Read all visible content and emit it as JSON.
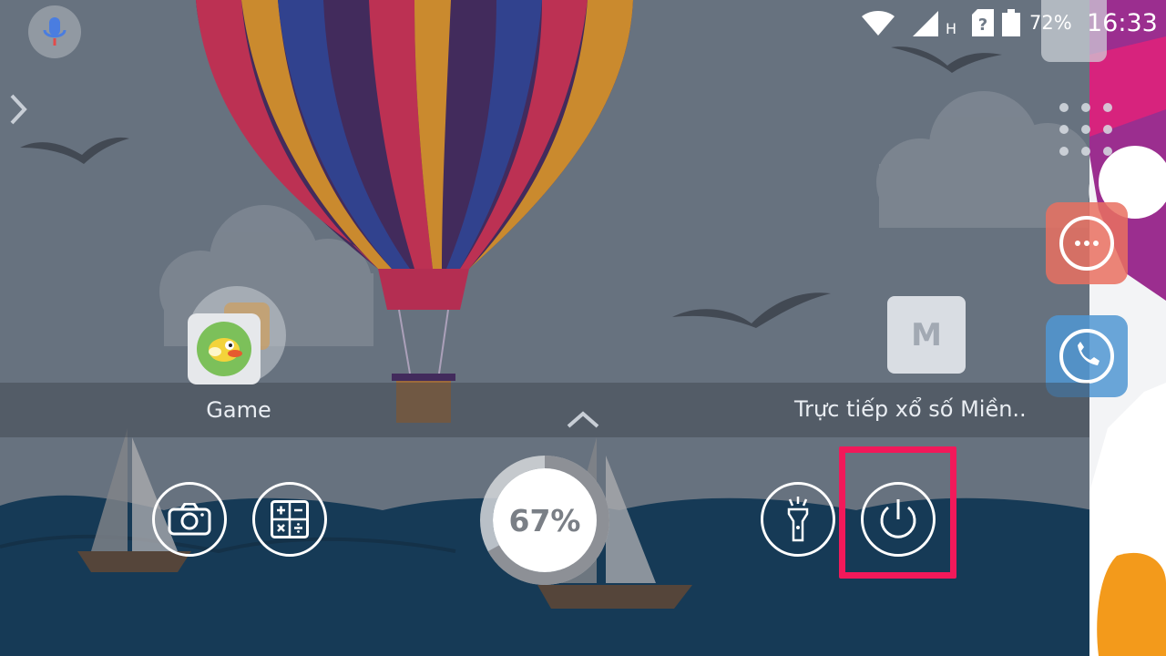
{
  "status_bar": {
    "network_letter": "H",
    "battery_percent": "72%",
    "time": "16:33"
  },
  "home": {
    "folder_label": "Game",
    "shortcut_label": "Trực tiếp xổ số Miền..",
    "m_app_letter": "M"
  },
  "quick_panel": {
    "memory_percent_text": "67%",
    "memory_fraction": 0.67
  },
  "icons": [
    "mic-icon",
    "chevron-right-icon",
    "chevron-up-icon",
    "camera-icon",
    "calculator-icon",
    "flashlight-icon",
    "power-icon",
    "wifi-icon",
    "signal-icon",
    "sim-unknown-icon",
    "battery-icon"
  ],
  "colors": {
    "highlight": "#f2195a",
    "sea": "#123a57",
    "sky": "#6f7a87"
  }
}
